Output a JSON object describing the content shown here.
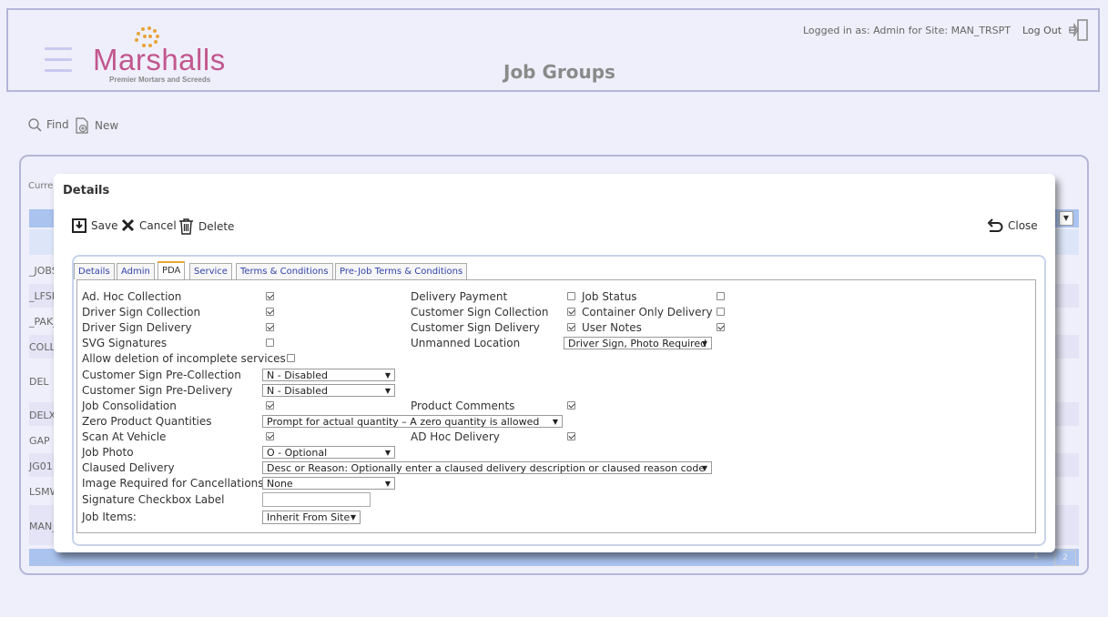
{
  "header": {
    "logo_text": "Marshalls",
    "logo_sub": "Premier Mortars and Screeds",
    "title": "Job Groups",
    "logged_in": "Logged in as: Admin for Site: MAN_TRSPT",
    "logout": "Log Out"
  },
  "toolbar": {
    "find": "Find",
    "new": "New"
  },
  "background": {
    "curr_label": "Curre",
    "rows": [
      "_JOBS",
      "_LFSR",
      "_PAK_",
      "COLL",
      "DEL",
      "DELX",
      "GAP",
      "JG01",
      "LSMW",
      "MAN_"
    ],
    "pager": [
      "1",
      "2"
    ]
  },
  "dialog": {
    "title": "Details",
    "actions": {
      "save": "Save",
      "cancel": "Cancel",
      "delete": "Delete",
      "close": "Close"
    },
    "tabs": [
      "Details",
      "Admin",
      "PDA",
      "Service",
      "Terms & Conditions",
      "Pre-Job Terms & Conditions"
    ],
    "active_tab": "PDA"
  },
  "pda": {
    "ad_hoc_collection": {
      "label": "Ad. Hoc Collection",
      "checked": true
    },
    "delivery_payment": {
      "label": "Delivery Payment",
      "checked": false
    },
    "job_status": {
      "label": "Job Status",
      "checked": false
    },
    "driver_sign_collection": {
      "label": "Driver Sign Collection",
      "checked": true
    },
    "customer_sign_collection": {
      "label": "Customer Sign Collection",
      "checked": true
    },
    "container_only_delivery": {
      "label": "Container Only Delivery",
      "checked": false
    },
    "driver_sign_delivery": {
      "label": "Driver Sign Delivery",
      "checked": true
    },
    "customer_sign_delivery": {
      "label": "Customer Sign Delivery",
      "checked": true
    },
    "user_notes": {
      "label": "User Notes",
      "checked": true
    },
    "svg_signatures": {
      "label": "SVG Signatures",
      "checked": false
    },
    "unmanned_location": {
      "label": "Unmanned Location",
      "value": "Driver Sign, Photo Required"
    },
    "allow_deletion": {
      "label": "Allow deletion of incomplete services",
      "checked": false
    },
    "customer_sign_pre_collection": {
      "label": "Customer Sign Pre-Collection",
      "value": "N - Disabled"
    },
    "customer_sign_pre_delivery": {
      "label": "Customer Sign Pre-Delivery",
      "value": "N - Disabled"
    },
    "job_consolidation": {
      "label": "Job Consolidation",
      "checked": true
    },
    "product_comments": {
      "label": "Product Comments",
      "checked": true
    },
    "zero_product_quantities": {
      "label": "Zero Product Quantities",
      "value": "Prompt for actual quantity – A zero quantity is allowed"
    },
    "scan_at_vehicle": {
      "label": "Scan At Vehicle",
      "checked": true
    },
    "ad_hoc_delivery": {
      "label": "AD Hoc Delivery",
      "checked": true
    },
    "job_photo": {
      "label": "Job Photo",
      "value": "O - Optional"
    },
    "claused_delivery": {
      "label": "Claused Delivery",
      "value": "Desc or Reason: Optionally enter a claused delivery description or claused reason code"
    },
    "image_required": {
      "label": "Image Required for Cancellations",
      "value": "None"
    },
    "signature_checkbox_label": {
      "label": "Signature Checkbox Label",
      "value": ""
    },
    "job_items": {
      "label": "Job Items:",
      "value": "Inherit From Site"
    }
  }
}
